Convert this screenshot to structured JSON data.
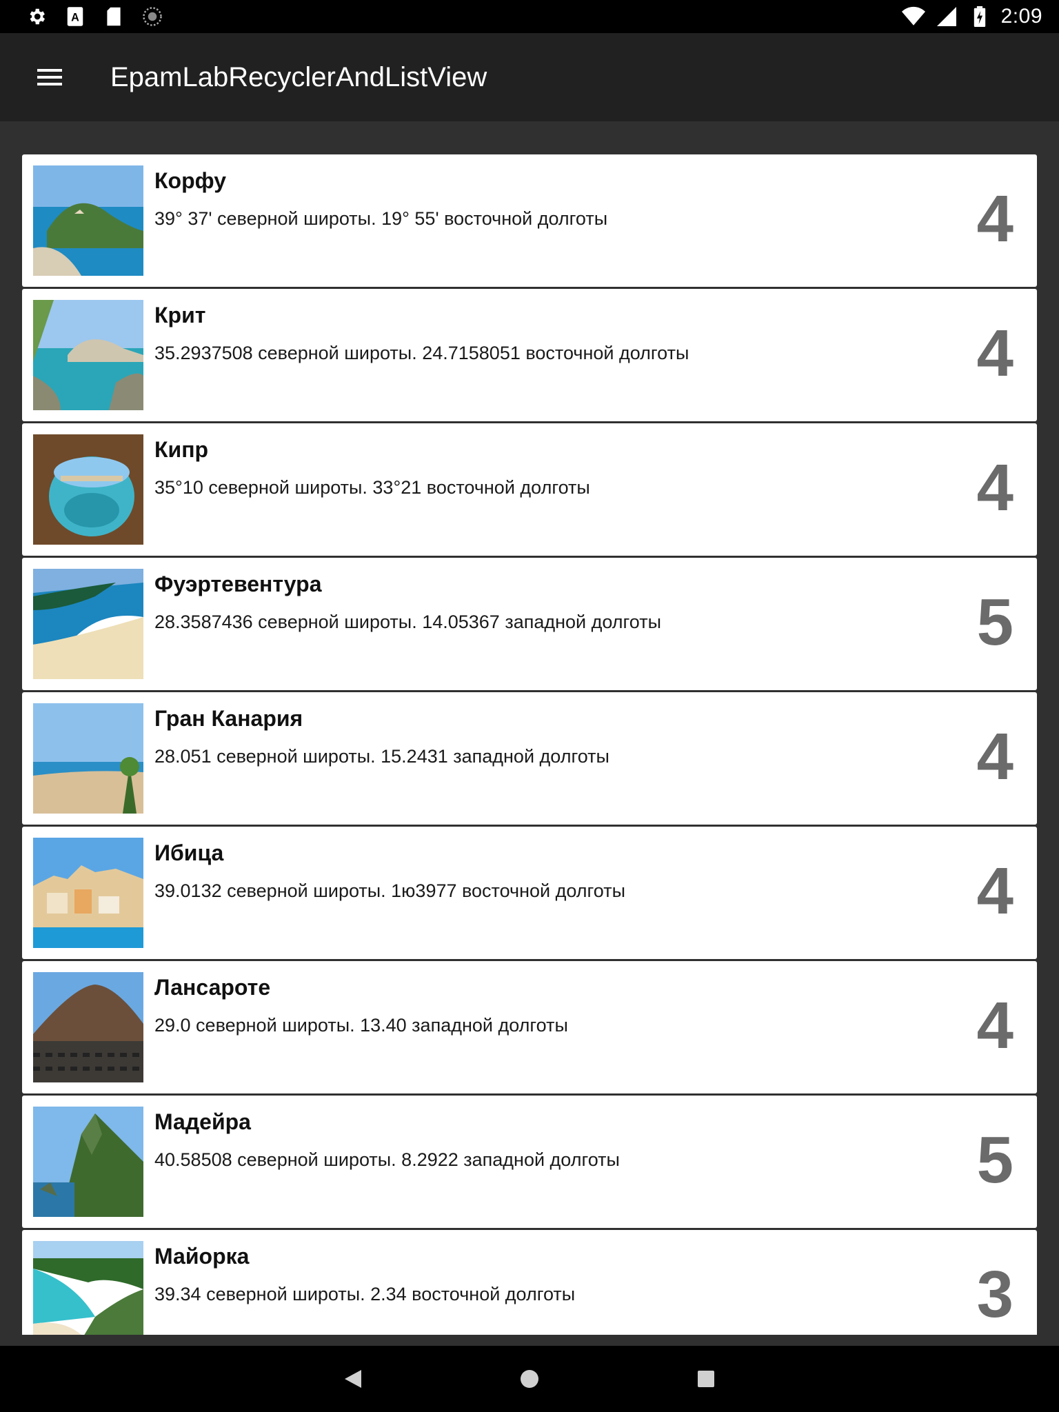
{
  "status_bar": {
    "time": "2:09",
    "left_icons": [
      "settings-icon",
      "accessibility-icon",
      "sd-card-icon",
      "sync-icon"
    ],
    "right_icons": [
      "wifi-icon",
      "signal-icon",
      "battery-icon"
    ]
  },
  "app_bar": {
    "title": "EpamLabRecyclerAndListView",
    "menu_icon": "menu-icon"
  },
  "items": [
    {
      "title": "Корфу",
      "coords": "39° 37' северной широты. 19° 55' восточной долготы",
      "rating": "4"
    },
    {
      "title": "Крит",
      "coords": "35.2937508 северной широты. 24.7158051 восточной долготы",
      "rating": "4"
    },
    {
      "title": "Кипр",
      "coords": "35°10 северной широты. 33°21 восточной долготы",
      "rating": "4"
    },
    {
      "title": "Фуэртевентура",
      "coords": "28.3587436 северной широты. 14.05367 западной долготы",
      "rating": "5"
    },
    {
      "title": "Гран Канария",
      "coords": "28.051 северной широты. 15.2431 западной долготы",
      "rating": "4"
    },
    {
      "title": "Ибица",
      "coords": "39.0132 северной широты. 1ю3977 восточной долготы",
      "rating": "4"
    },
    {
      "title": "Лансароте",
      "coords": "29.0 северной широты. 13.40 западной долготы",
      "rating": "4"
    },
    {
      "title": "Мадейра",
      "coords": "40.58508 северной широты. 8.2922 западной долготы",
      "rating": "5"
    },
    {
      "title": "Майорка",
      "coords": "39.34 северной широты. 2.34 восточной долготы",
      "rating": "3"
    }
  ],
  "nav_bar": {
    "icons": [
      "back-icon",
      "home-icon",
      "recents-icon"
    ]
  }
}
